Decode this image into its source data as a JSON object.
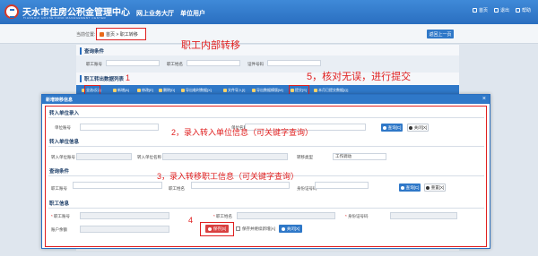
{
  "header": {
    "title": "天水市住房公积金管理中心",
    "subtitle": "TIANSHUI HOUSE FUND MANAGEMENT CENTER",
    "hall": "网上业务大厅",
    "user_type": "单位用户",
    "nav": [
      {
        "label": "首页",
        "icon": "home-icon"
      },
      {
        "label": "退出",
        "icon": "logout-icon"
      },
      {
        "label": "帮助",
        "icon": "help-icon"
      }
    ]
  },
  "breadcrumb": {
    "label": "当前位置:",
    "path": "首页 > 职工转移",
    "back_button": "返回上一页"
  },
  "background": {
    "query_title": "查询条件",
    "query_fields": [
      "职工账号",
      "职工姓名",
      "证件号码"
    ],
    "list_title": "职工转出数据列表",
    "toolbar": [
      "全选/反选",
      "新增[A]",
      "修改[E]",
      "删除[D]",
      "导出临时数据[X]",
      "文件导入[I]",
      "导出数据模版[M]",
      "提交[S]",
      "本月已提交数据[Q]"
    ]
  },
  "modal": {
    "title": "新增转移信息",
    "close": "×",
    "transfer_in_unit": {
      "heading": "转入单位录入",
      "account_label": "单位账号",
      "name_label": "单位名称",
      "query_button": "查询[C]",
      "close_button": "关闭[X]"
    },
    "transfer_in_info": {
      "heading": "转入单位信息",
      "account_label": "转入单位账号",
      "name_label": "转入单位名称",
      "type_label": "转移类型",
      "type_value": "工作调动"
    },
    "query": {
      "heading": "查询条件",
      "account_label": "职工账号",
      "name_label": "职工姓名",
      "id_label": "身份证号码",
      "query_button": "查询[C]",
      "reset_button": "重置[X]"
    },
    "employee": {
      "heading": "职工信息",
      "account_label": "职工账号",
      "name_label": "职工姓名",
      "id_label": "身份证号码",
      "balance_label": "账户余额",
      "save_button": "保存[S]",
      "keep_label": "保存并继续新增[A]",
      "close_button": "关闭[X]"
    }
  },
  "annotations": {
    "a1": "1",
    "a_transfer": "职工内部转移",
    "a2": "2，录入转入单位信息（可关键字查询）",
    "a3": "3，录入转移职工信息（可关键字查询）",
    "a4": "4",
    "a5": "5，核对无误，进行提交"
  }
}
